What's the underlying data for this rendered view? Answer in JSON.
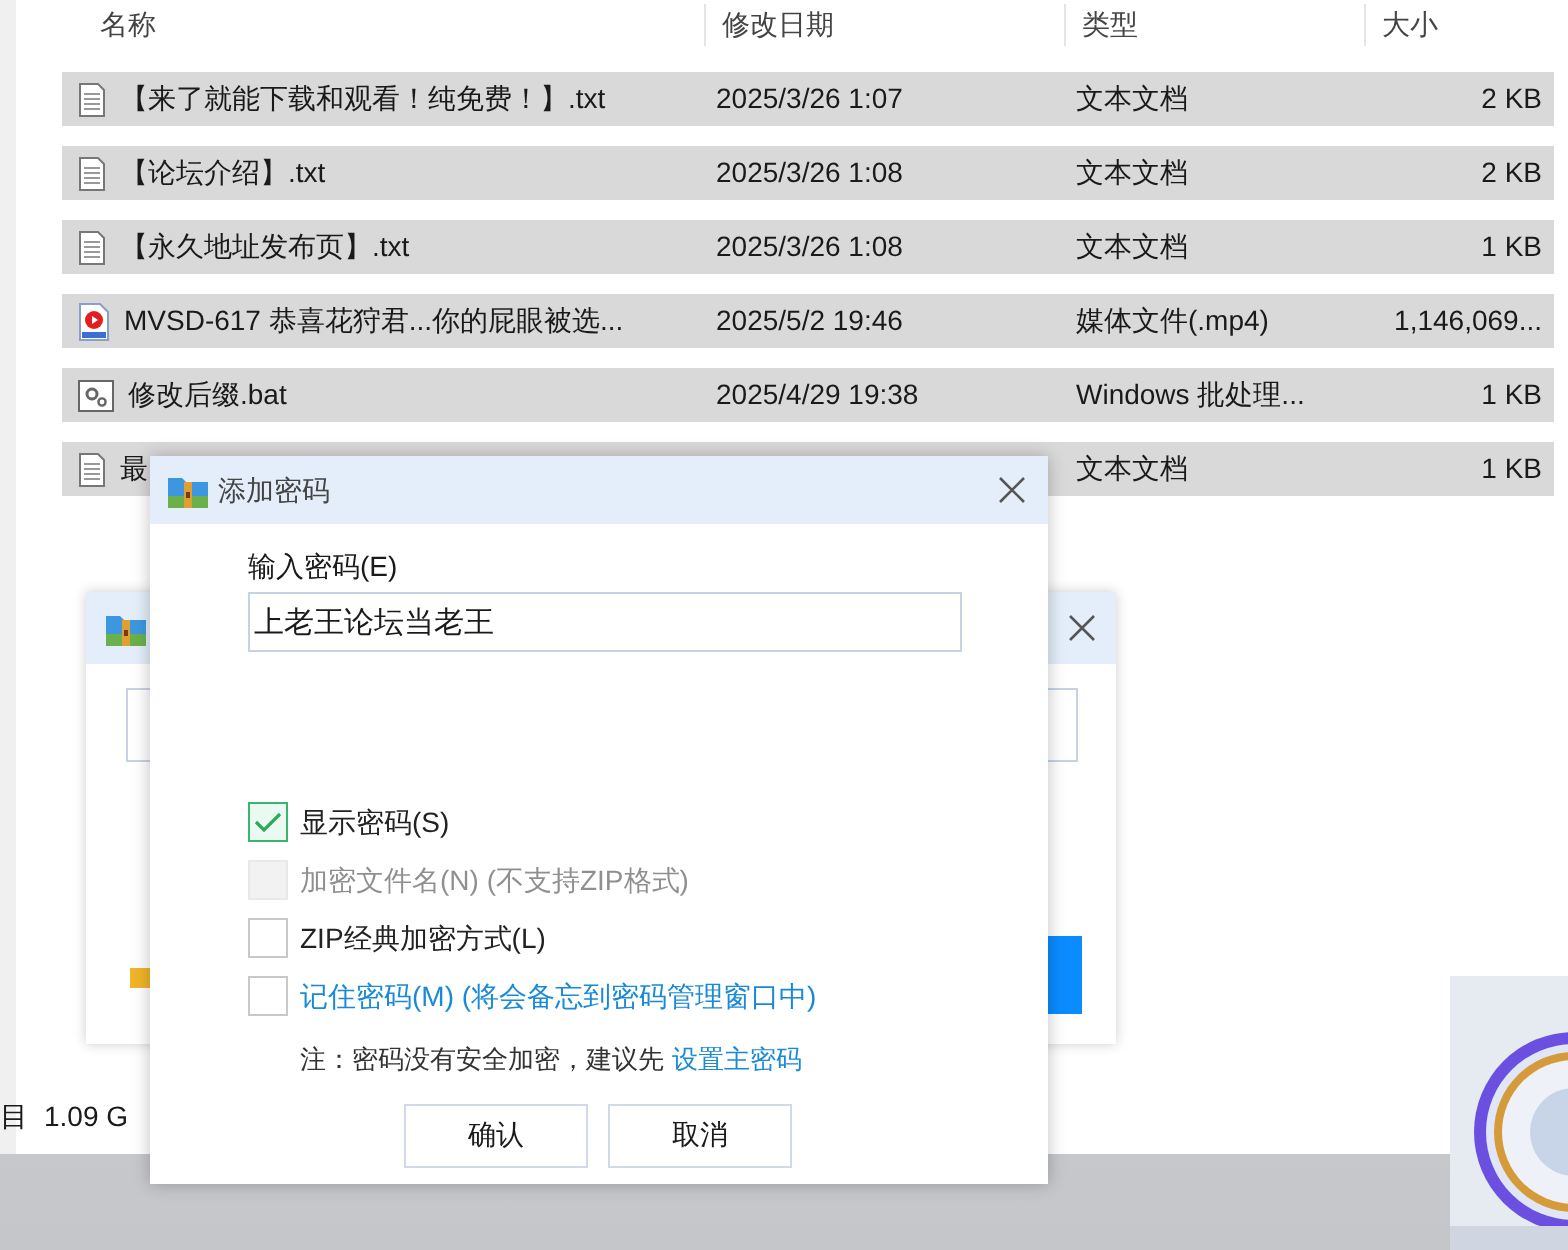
{
  "file_list": {
    "columns": [
      "名称",
      "修改日期",
      "类型",
      "大小"
    ],
    "rows": [
      {
        "kind": "text",
        "name": "【来了就能下载和观看！纯免费！】.txt",
        "date": "2025/3/26 1:07",
        "type": "文本文档",
        "size": "2 KB"
      },
      {
        "kind": "text",
        "name": "【论坛介绍】.txt",
        "date": "2025/3/26 1:08",
        "type": "文本文档",
        "size": "2 KB"
      },
      {
        "kind": "text",
        "name": "【永久地址发布页】.txt",
        "date": "2025/3/26 1:08",
        "type": "文本文档",
        "size": "1 KB"
      },
      {
        "kind": "video",
        "name": "MVSD-617 恭喜花狩君...你的屁眼被选...",
        "date": "2025/5/2 19:46",
        "type": "媒体文件(.mp4)",
        "size": "1,146,069..."
      },
      {
        "kind": "script",
        "name": "修改后缀.bat",
        "date": "2025/4/29 19:38",
        "type": "Windows 批处理...",
        "size": "1 KB"
      },
      {
        "kind": "text",
        "name": "最",
        "date": "",
        "type": "文本文档",
        "size": "1 KB"
      }
    ]
  },
  "status_bar": {
    "items": "目",
    "size": "1.09 G"
  },
  "password_dialog": {
    "title": "添加密码",
    "field_label": "输入密码(E)",
    "password": "上老王论坛当老王",
    "options": [
      {
        "kind": "plain",
        "label": "显示密码(S)",
        "checked": true,
        "disabled": false
      },
      {
        "kind": "plain",
        "label": "加密文件名(N) (不支持ZIP格式)",
        "checked": false,
        "disabled": true
      },
      {
        "kind": "plain",
        "label": "ZIP经典加密方式(L)",
        "checked": false,
        "disabled": false
      },
      {
        "kind": "link",
        "label": "记住密码(M) (将会备忘到密码管理窗口中)",
        "checked": false,
        "disabled": false
      }
    ],
    "note": "注：密码没有安全加密，建议先",
    "note_link": "设置主密码",
    "buttons": [
      "确认",
      "取消"
    ]
  }
}
